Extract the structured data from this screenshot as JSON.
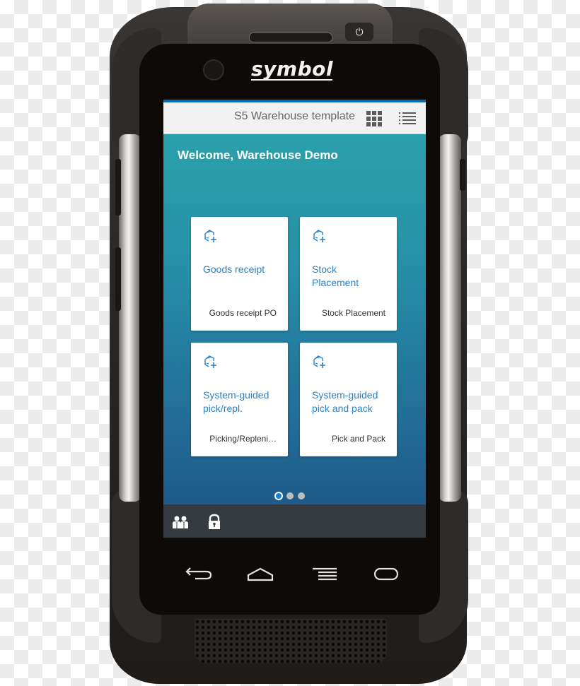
{
  "device": {
    "brand": "symbol"
  },
  "shell": {
    "title": "S5 Warehouse template",
    "icons": [
      "app-grid-icon",
      "list-view-icon"
    ]
  },
  "home": {
    "welcome": "Welcome, Warehouse Demo",
    "tiles": [
      {
        "title": "Goods receipt",
        "subtitle": "Goods receipt PO",
        "icon": "box-add-icon"
      },
      {
        "title": "Stock Placement",
        "subtitle": "Stock Placement",
        "icon": "box-add-icon"
      },
      {
        "title": "System-guided pick/repl.",
        "subtitle": "Picking/Repleni…",
        "icon": "box-add-icon"
      },
      {
        "title": "System-guided pick and pack",
        "subtitle": "Pick and Pack",
        "icon": "box-add-icon"
      }
    ],
    "pager": {
      "pages": 3,
      "current": 1
    }
  },
  "footer": {
    "buttons": [
      "users-icon",
      "lock-icon"
    ]
  },
  "android_nav": [
    "back-icon",
    "home-icon",
    "recent-apps-icon",
    "menu-icon"
  ],
  "colors": {
    "accent": "#0a6ab3",
    "tile_title": "#2a81c4",
    "gradient_top": "#2ba0ab",
    "gradient_bottom": "#1e5a8a",
    "footer": "#353b40",
    "active_dot": "#1b83cf"
  }
}
